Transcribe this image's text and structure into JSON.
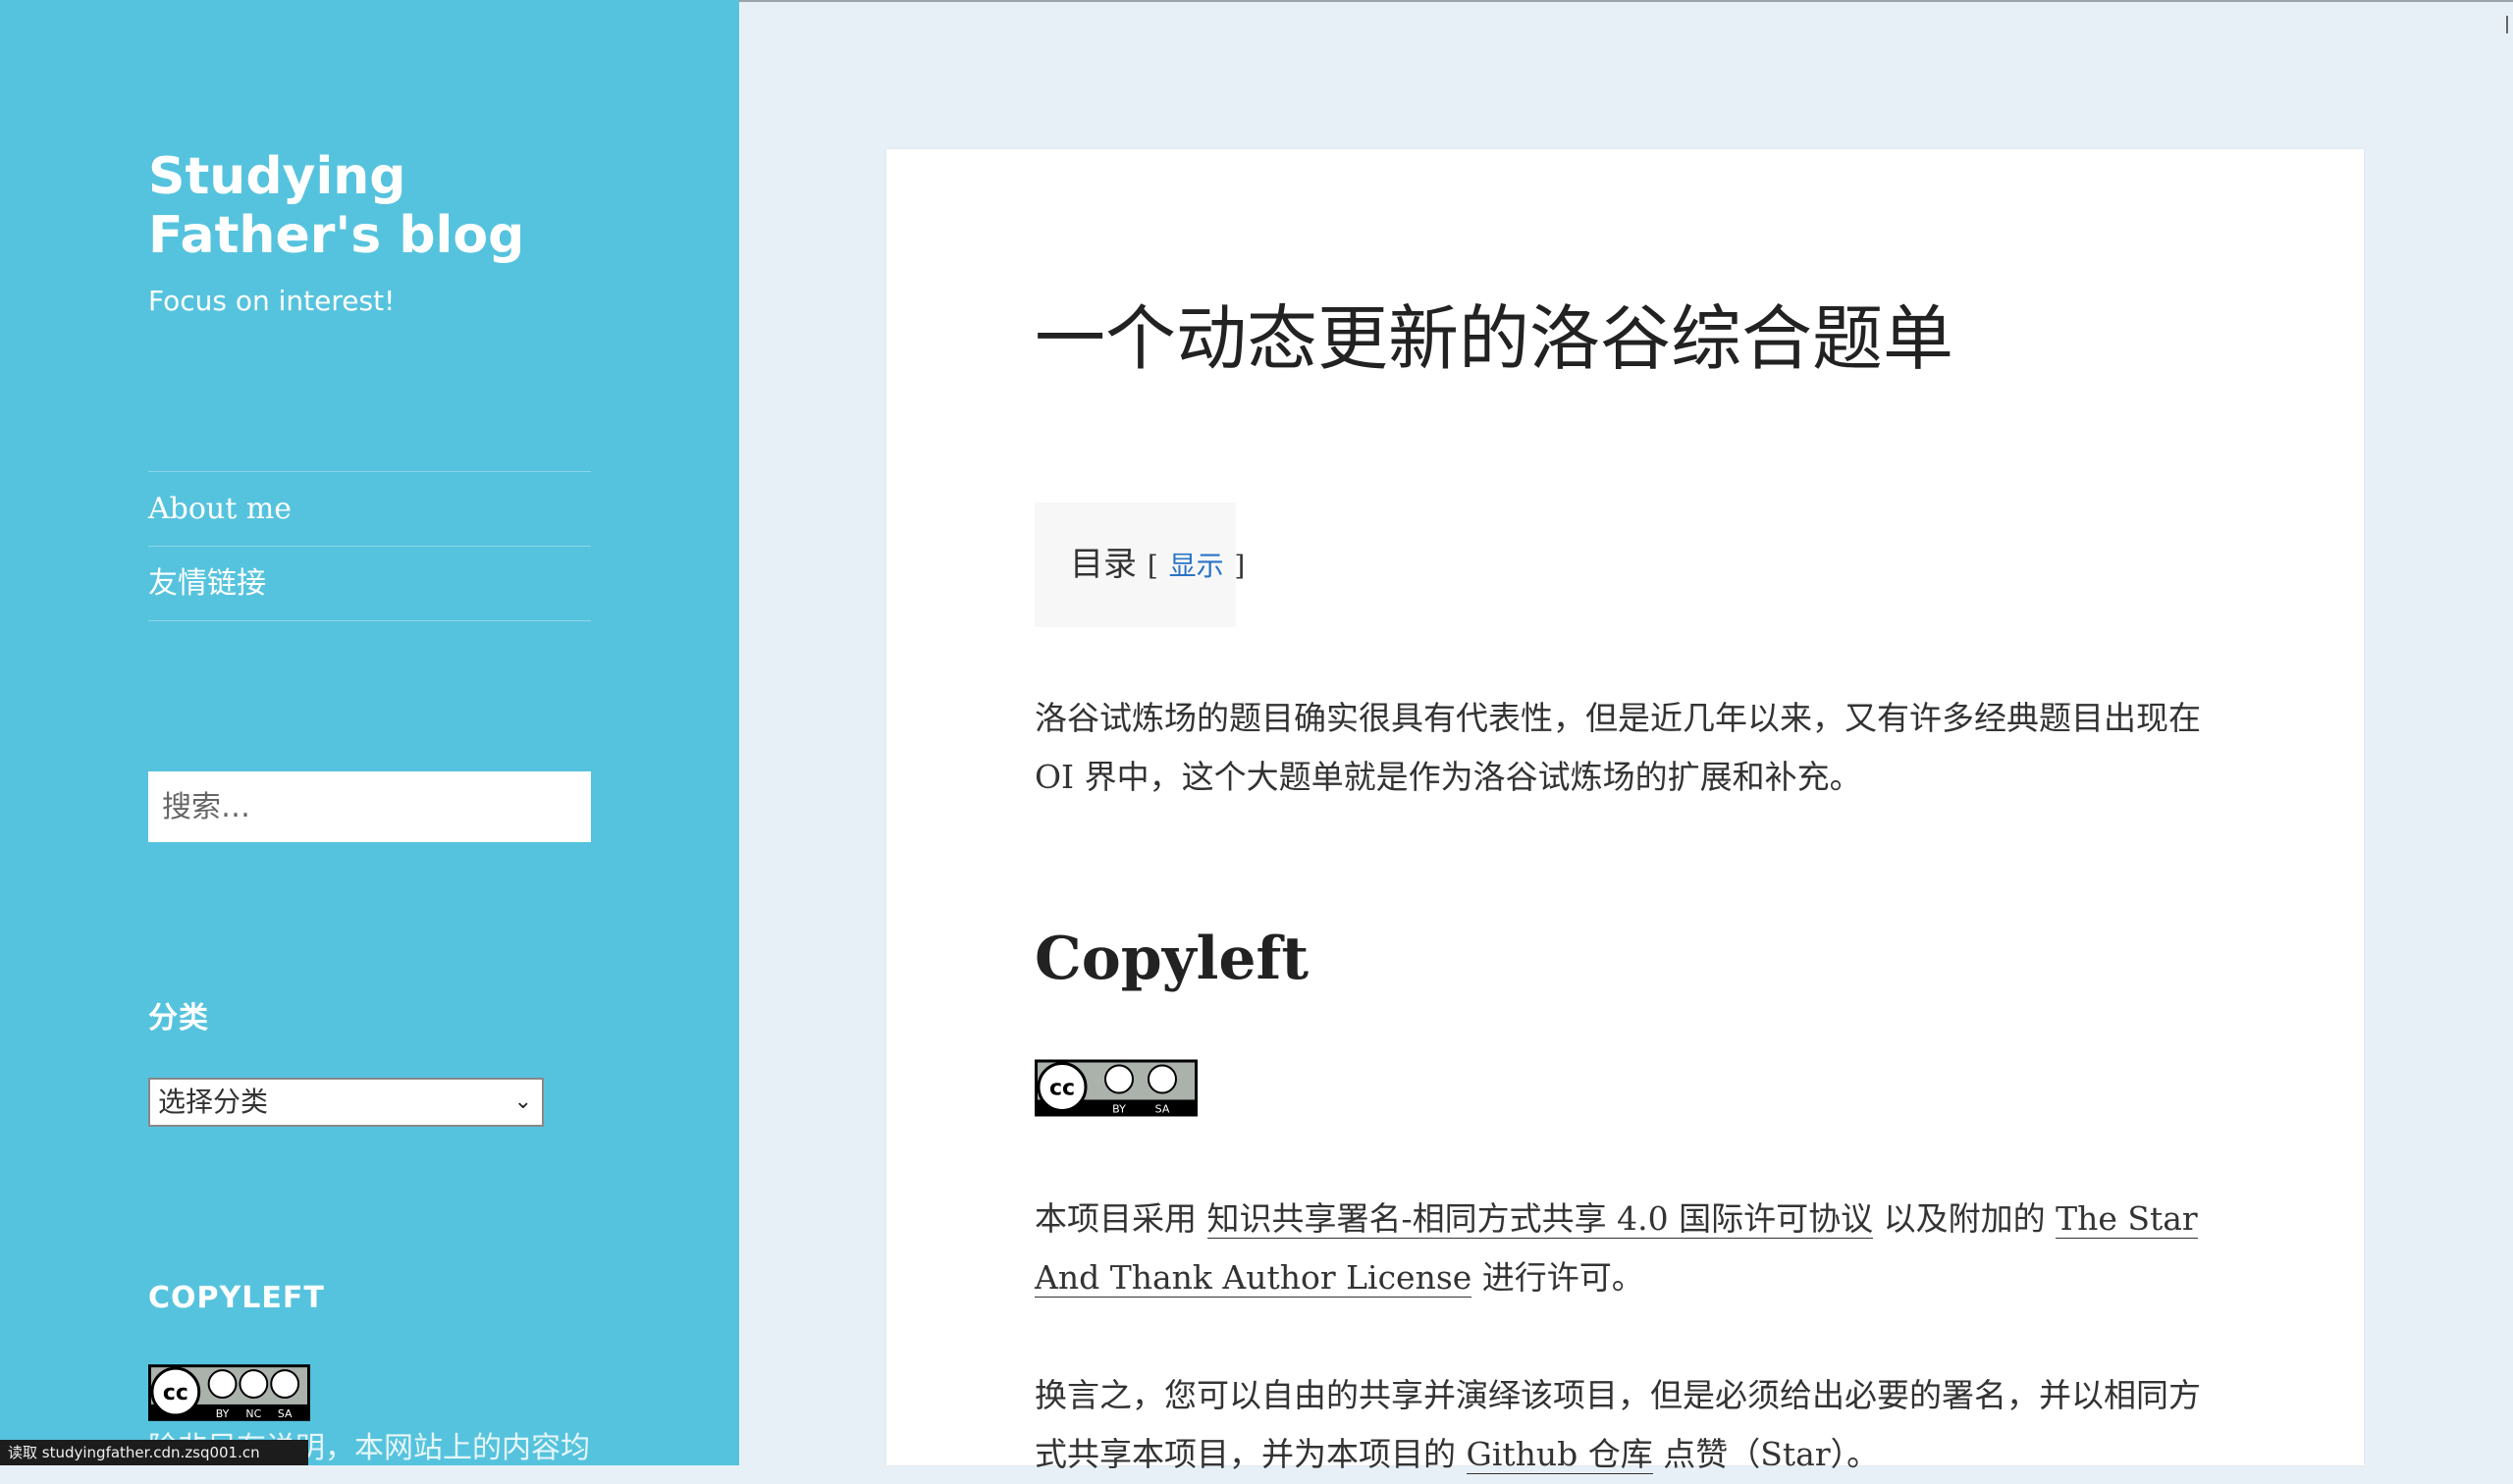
{
  "sidebar": {
    "site_title": "Studying Father's blog",
    "site_description": "Focus on interest!",
    "nav": [
      {
        "label": "About me"
      },
      {
        "label": "友情链接"
      }
    ],
    "search": {
      "placeholder": "搜索…"
    },
    "categories": {
      "title": "分类",
      "select_value": "选择分类"
    },
    "copyleft": {
      "title": "COPYLEFT",
      "text": "除非另有说明，本网站上的内容均"
    }
  },
  "status_bar": {
    "text": "读取 studyingfather.cdn.zsq001.cn"
  },
  "article": {
    "title": "一个动态更新的洛谷综合题单",
    "toc": {
      "label": "目录",
      "open_bracket": "[",
      "toggle": "显示",
      "close_bracket": "]"
    },
    "intro": "洛谷试炼场的题目确实很具有代表性，但是近几年以来，又有许多经典题目出现在 OI 界中，这个大题单就是作为洛谷试炼场的扩展和补充。",
    "copyleft_heading": "Copyleft",
    "license_para": {
      "prefix": "本项目采用 ",
      "link1": "知识共享署名-相同方式共享 4.0 国际许可协议",
      "middle": " 以及附加的 ",
      "link2": "The Star And Thank Author License",
      "suffix": " 进行许可。"
    },
    "share_para": {
      "prefix": "换言之，您可以自由的共享并演绎该项目，但是必须给出必要的署名，并以相同方式共享本项目，并为本项目的 ",
      "link": "Github 仓库",
      "suffix": " 点赞（Star）。"
    },
    "badge_labels": {
      "cc": "cc",
      "by": "BY",
      "sa": "SA",
      "nc": "NC"
    }
  },
  "colors": {
    "sidebar_bg": "#56c3de",
    "page_bg": "#e8f0f7",
    "link_blue": "#2a73c6"
  },
  "icons": [
    "cc-by-sa-badge-icon",
    "cc-by-nc-sa-badge-icon",
    "chevron-down-icon"
  ]
}
